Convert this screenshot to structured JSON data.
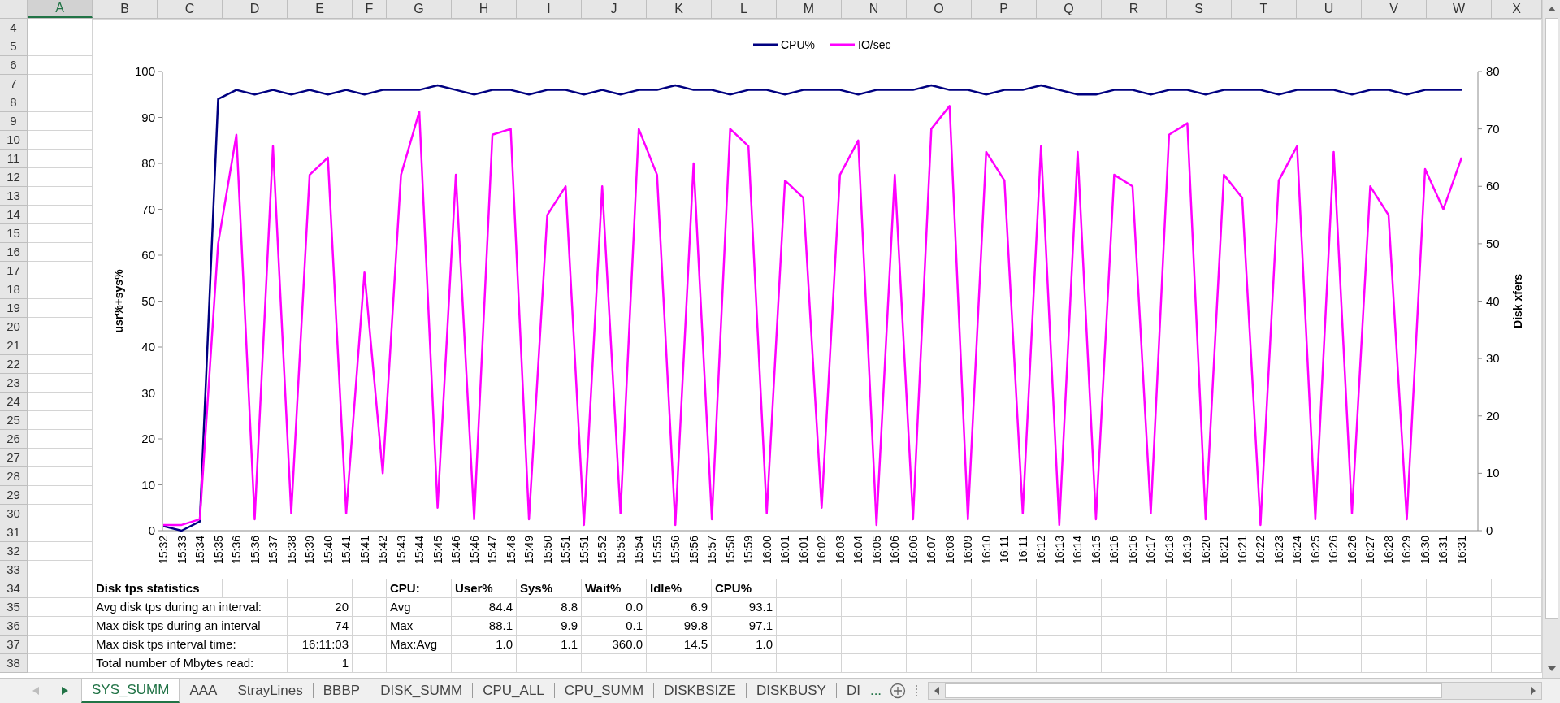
{
  "column_headers": [
    {
      "label": "A",
      "selected": true
    },
    {
      "label": "B",
      "selected": false
    },
    {
      "label": "C",
      "selected": false
    },
    {
      "label": "D",
      "selected": false
    },
    {
      "label": "E",
      "selected": false
    },
    {
      "label": "F",
      "selected": false
    },
    {
      "label": "G",
      "selected": false
    },
    {
      "label": "H",
      "selected": false
    },
    {
      "label": "I",
      "selected": false
    },
    {
      "label": "J",
      "selected": false
    },
    {
      "label": "K",
      "selected": false
    },
    {
      "label": "L",
      "selected": false
    },
    {
      "label": "M",
      "selected": false
    },
    {
      "label": "N",
      "selected": false
    },
    {
      "label": "O",
      "selected": false
    },
    {
      "label": "P",
      "selected": false
    },
    {
      "label": "Q",
      "selected": false
    },
    {
      "label": "R",
      "selected": false
    },
    {
      "label": "S",
      "selected": false
    },
    {
      "label": "T",
      "selected": false
    },
    {
      "label": "U",
      "selected": false
    },
    {
      "label": "V",
      "selected": false
    },
    {
      "label": "W",
      "selected": false
    },
    {
      "label": "X",
      "selected": false
    }
  ],
  "row_headers": [
    "4",
    "5",
    "6",
    "7",
    "8",
    "9",
    "10",
    "11",
    "12",
    "13",
    "14",
    "15",
    "16",
    "17",
    "18",
    "19",
    "20",
    "21",
    "22",
    "23",
    "24",
    "25",
    "26",
    "27",
    "28",
    "29",
    "30",
    "31",
    "32",
    "33",
    "34",
    "35",
    "36",
    "37",
    "38"
  ],
  "chart": {
    "chart_data": {
      "type": "line",
      "legend": "top",
      "ylabel": "usr%+sys%",
      "y2label": "Disk xfers",
      "ylim": [
        0,
        100
      ],
      "yticks": [
        0,
        10,
        20,
        30,
        40,
        50,
        60,
        70,
        80,
        90,
        100
      ],
      "y2lim": [
        0,
        80
      ],
      "y2ticks": [
        0,
        10,
        20,
        30,
        40,
        50,
        60,
        70,
        80
      ],
      "categories": [
        "15:32",
        "15:33",
        "15:34",
        "15:35",
        "15:36",
        "15:36",
        "15:37",
        "15:38",
        "15:39",
        "15:40",
        "15:41",
        "15:41",
        "15:42",
        "15:43",
        "15:44",
        "15:45",
        "15:46",
        "15:46",
        "15:47",
        "15:48",
        "15:49",
        "15:50",
        "15:51",
        "15:51",
        "15:52",
        "15:53",
        "15:54",
        "15:55",
        "15:56",
        "15:56",
        "15:57",
        "15:58",
        "15:59",
        "16:00",
        "16:01",
        "16:01",
        "16:02",
        "16:03",
        "16:04",
        "16:05",
        "16:06",
        "16:06",
        "16:07",
        "16:08",
        "16:09",
        "16:10",
        "16:11",
        "16:11",
        "16:12",
        "16:13",
        "16:14",
        "16:15",
        "16:16",
        "16:16",
        "16:17",
        "16:18",
        "16:19",
        "16:20",
        "16:21",
        "16:21",
        "16:22",
        "16:23",
        "16:24",
        "16:25",
        "16:26",
        "16:26",
        "16:27",
        "16:28",
        "16:29",
        "16:30",
        "16:31",
        "16:31"
      ],
      "series": [
        {
          "name": "CPU%",
          "color": "#000080",
          "values": [
            1,
            0,
            2,
            94,
            96,
            95,
            96,
            95,
            96,
            95,
            96,
            95,
            96,
            96,
            96,
            97,
            96,
            95,
            96,
            96,
            95,
            96,
            96,
            95,
            96,
            95,
            96,
            96,
            97,
            96,
            96,
            95,
            96,
            96,
            95,
            96,
            96,
            96,
            95,
            96,
            96,
            96,
            97,
            96,
            96,
            95,
            96,
            96,
            97,
            96,
            95,
            95,
            96,
            96,
            95,
            96,
            96,
            95,
            96,
            96,
            96,
            95,
            96,
            96,
            96,
            95,
            96,
            96,
            95,
            96,
            96,
            96
          ]
        },
        {
          "name": "IO/sec",
          "color": "#ff00ff",
          "axis": "y2",
          "values": [
            1,
            1,
            2,
            50,
            69,
            2,
            67,
            3,
            62,
            65,
            3,
            45,
            10,
            62,
            73,
            4,
            62,
            2,
            69,
            70,
            2,
            55,
            60,
            1,
            60,
            3,
            70,
            62,
            1,
            64,
            2,
            70,
            67,
            3,
            61,
            58,
            4,
            62,
            68,
            1,
            62,
            2,
            70,
            74,
            2,
            66,
            61,
            3,
            67,
            1,
            66,
            2,
            62,
            60,
            3,
            69,
            71,
            2,
            62,
            58,
            1,
            61,
            67,
            2,
            66,
            3,
            60,
            55,
            2,
            63,
            56,
            65
          ]
        }
      ]
    }
  },
  "disk_stats": {
    "title": "Disk tps statistics",
    "rows": [
      {
        "label": "Avg disk tps during an interval:",
        "value": "20"
      },
      {
        "label": "Max disk tps during an interval",
        "value": "74"
      },
      {
        "label": "Max disk tps interval time:",
        "value": "16:11:03"
      },
      {
        "label": "Total number of Mbytes read:",
        "value": "1"
      }
    ]
  },
  "cpu_stats": {
    "columns": [
      "CPU:",
      "User%",
      "Sys%",
      "Wait%",
      "Idle%",
      "CPU%"
    ],
    "rows": [
      [
        "Avg",
        "84.4",
        "8.8",
        "0.0",
        "6.9",
        "93.1"
      ],
      [
        "Max",
        "88.1",
        "9.9",
        "0.1",
        "99.8",
        "97.1"
      ],
      [
        "Max:Avg",
        "1.0",
        "1.1",
        "360.0",
        "14.5",
        "1.0"
      ]
    ]
  },
  "sheet_tabs": [
    {
      "label": "SYS_SUMM",
      "selected": true
    },
    {
      "label": "AAA",
      "selected": false
    },
    {
      "label": "StrayLines",
      "selected": false
    },
    {
      "label": "BBBP",
      "selected": false
    },
    {
      "label": "DISK_SUMM",
      "selected": false
    },
    {
      "label": "CPU_ALL",
      "selected": false
    },
    {
      "label": "CPU_SUMM",
      "selected": false
    },
    {
      "label": "DISKBSIZE",
      "selected": false
    },
    {
      "label": "DISKBUSY",
      "selected": false
    },
    {
      "label": "DI",
      "selected": false
    }
  ],
  "tab_overflow": "..."
}
